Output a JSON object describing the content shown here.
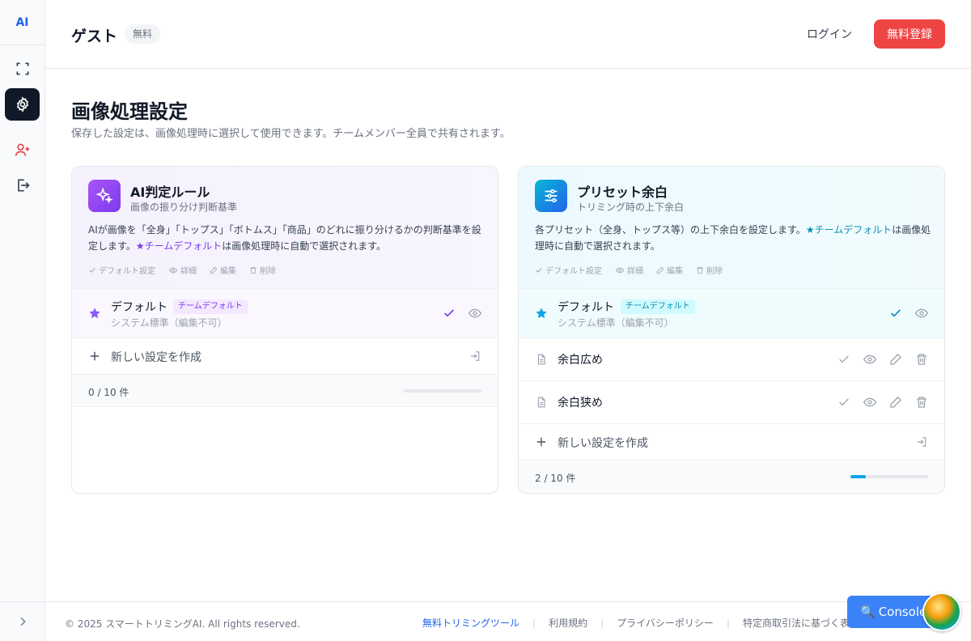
{
  "sidebar": {
    "logo": "AI",
    "items": [
      {
        "name": "fullscreen-icon"
      },
      {
        "name": "gear-icon"
      },
      {
        "name": "user-plus-icon"
      },
      {
        "name": "logout-icon"
      }
    ]
  },
  "header": {
    "user_name": "ゲスト",
    "plan_badge": "無料",
    "login_label": "ログイン",
    "signup_label": "無料登録"
  },
  "page": {
    "title": "画像処理設定",
    "subtitle": "保存した設定は、画像処理時に選択して使用できます。チームメンバー全員で共有されます。"
  },
  "legend": {
    "default": "デフォルト設定",
    "detail": "詳細",
    "edit": "編集",
    "delete": "削除"
  },
  "ai_card": {
    "title": "AI判定ルール",
    "subtitle": "画像の振り分け判断基準",
    "desc_before": "AIが画像を「全身」「トップス」「ボトムス」「商品」のどれに振り分けるかの判断基準を設定します。",
    "desc_link": "★チームデフォルト",
    "desc_after": "は画像処理時に自動で選択されます。",
    "default_row": {
      "name": "デフォルト",
      "badge": "チームデフォルト",
      "note": "システム標準（編集不可）"
    },
    "create_label": "新しい設定を作成",
    "count": "0 / 10 件",
    "progress": 0
  },
  "margin_card": {
    "title": "プリセット余白",
    "subtitle": "トリミング時の上下余白",
    "desc_before": "各プリセット（全身、トップス等）の上下余白を設定します。",
    "desc_link": "★チームデフォルト",
    "desc_after": "は画像処理時に自動で選択されます。",
    "default_row": {
      "name": "デフォルト",
      "badge": "チームデフォルト",
      "note": "システム標準（編集不可）"
    },
    "items": [
      {
        "name": "余白広め"
      },
      {
        "name": "余白狭め"
      }
    ],
    "create_label": "新しい設定を作成",
    "count": "2 / 10 件",
    "progress": 0.2
  },
  "footer": {
    "copyright": "© 2025 スマートトリミングAI. All rights reserved.",
    "links": [
      "無料トリミングツール",
      "利用規約",
      "プライバシーポリシー",
      "特定商取引法に基づく表示"
    ],
    "console_label": "Console"
  },
  "colors": {
    "accent_red": "#ef4444",
    "accent_purple": "#7c3aed",
    "accent_cyan": "#0891b2",
    "link_blue": "#2563eb"
  }
}
